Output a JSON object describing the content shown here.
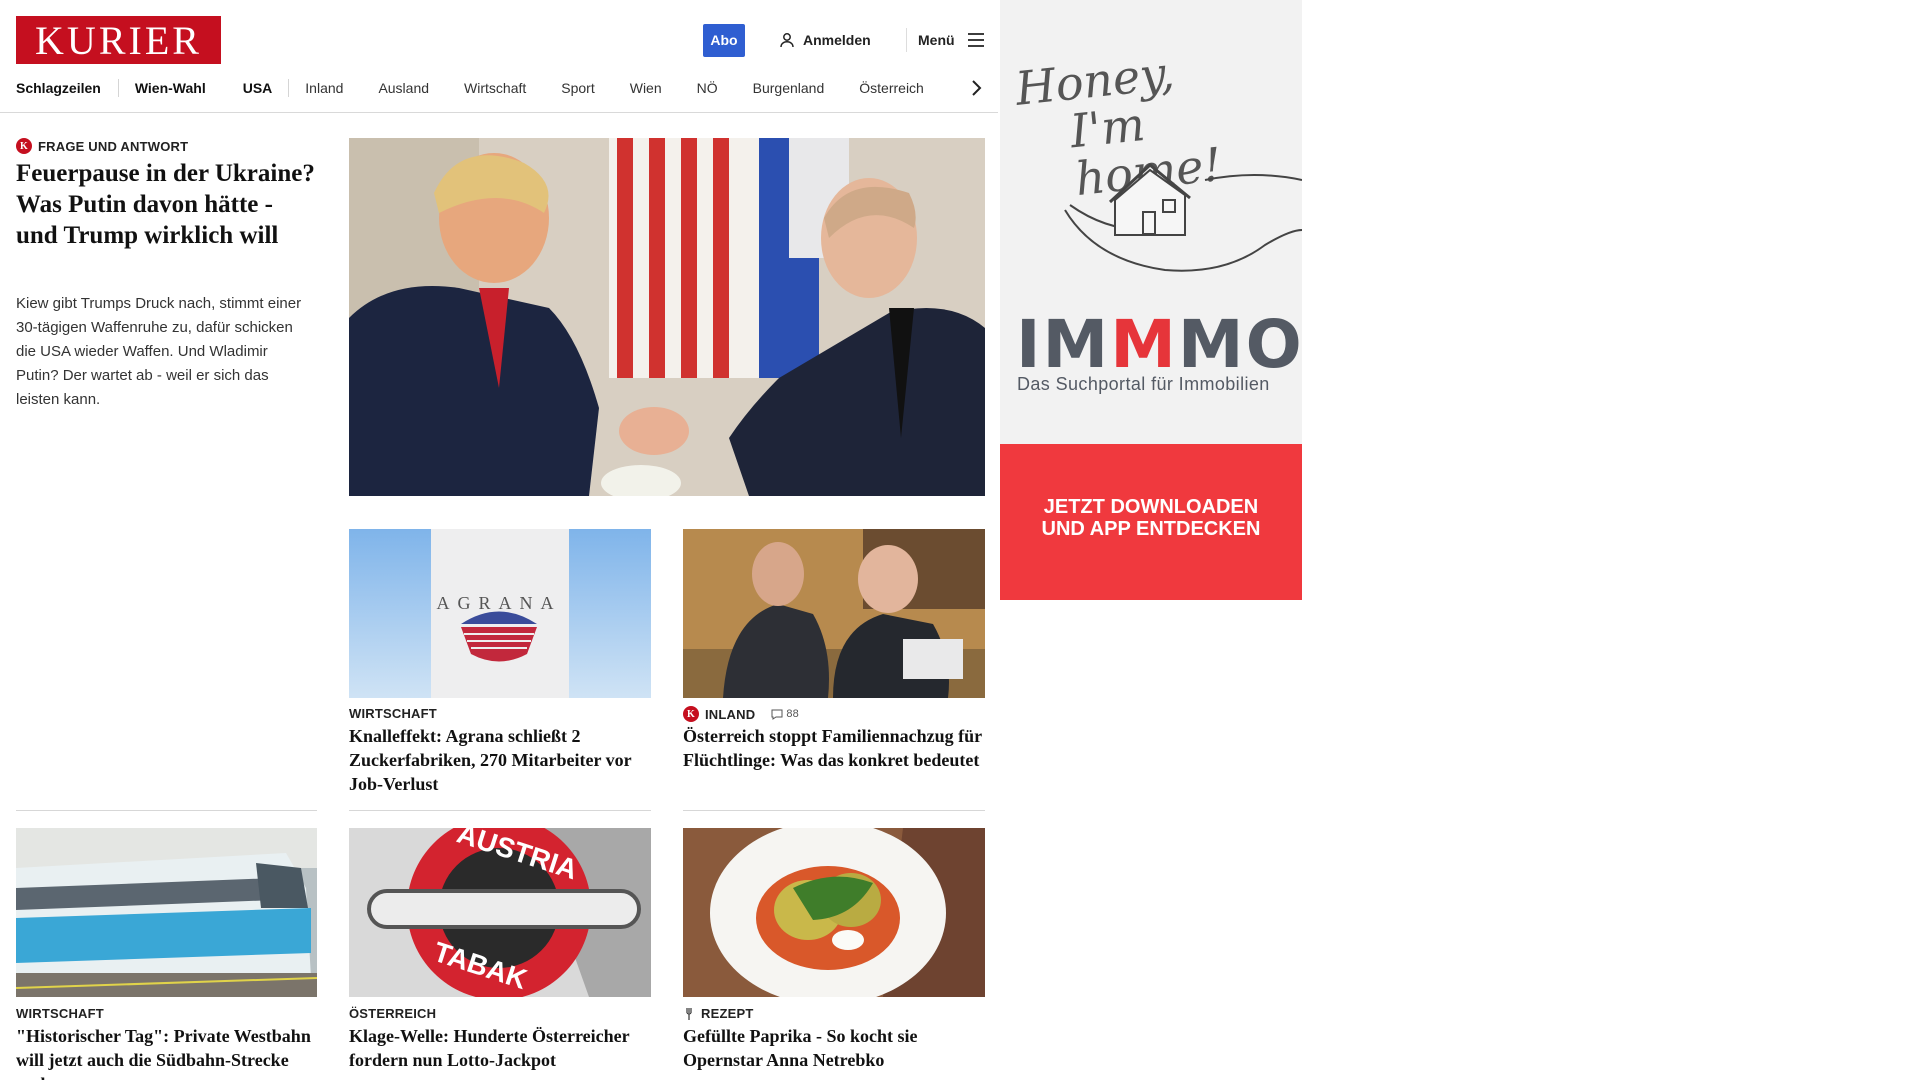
{
  "header": {
    "logo": "KURIER",
    "abo_label": "Abo",
    "login_label": "Anmelden",
    "menu_label": "Menü"
  },
  "nav": [
    "Schlagzeilen",
    "Wien-Wahl",
    "USA",
    "Inland",
    "Ausland",
    "Wirtschaft",
    "Sport",
    "Wien",
    "NÖ",
    "Burgenland",
    "Österreich"
  ],
  "lead": {
    "kicker": "FRAGE UND ANTWORT",
    "title": "Feuerpause in der Ukraine? Was Putin davon hätte - und Trump wirklich will",
    "text": "Kiew gibt Trumps Druck nach, stimmt einer 30-tägigen Waffenruhe zu, dafür schicken die USA wieder Waffen. Und Wladimir Putin? Der wartet ab - weil er sich das leisten kann."
  },
  "cards": [
    {
      "kicker": "WIRTSCHAFT",
      "title": "Knalleffekt: Agrana schließt 2 Zuckerfabriken, 270 Mitarbeiter vor Job-Verlust"
    },
    {
      "kicker": "INLAND",
      "comments": "88",
      "title": "Österreich stoppt Familiennachzug für Flüchtlinge: Was das konkret bedeutet"
    },
    {
      "kicker": "WIRTSCHAFT",
      "title": "\"Historischer Tag\": Private Westbahn will jetzt auch die Südbahn-Strecke erobern"
    },
    {
      "kicker": "ÖSTERREICH",
      "title": "Klage-Welle: Hunderte Österreicher fordern nun Lotto-Jackpot"
    },
    {
      "kicker": "REZEPT",
      "title": "Gefüllte Paprika - So kocht sie Opernstar Anna Netrebko"
    }
  ],
  "image_text": {
    "agrana": "AGRANA",
    "austria_tabak_top": "AUSTRIA",
    "austria_tabak_bottom": "TABAK"
  },
  "ad": {
    "script_line1": "Honey,",
    "script_line2": "I'm home!",
    "logo_a": "IM",
    "logo_b": "M",
    "logo_c": "MO",
    "subtitle": "Das Suchportal für Immobilien",
    "cta_line1": "JETZT DOWNLOADEN",
    "cta_line2": "UND APP ENTDECKEN"
  },
  "colors": {
    "brand": "#c50f1f",
    "abo": "#2f5ed1",
    "ad_red": "#f0393e"
  },
  "icons": [
    "user-icon",
    "hamburger-icon",
    "chevron-right-icon",
    "kurier-badge-icon",
    "comment-icon",
    "fork-icon"
  ]
}
